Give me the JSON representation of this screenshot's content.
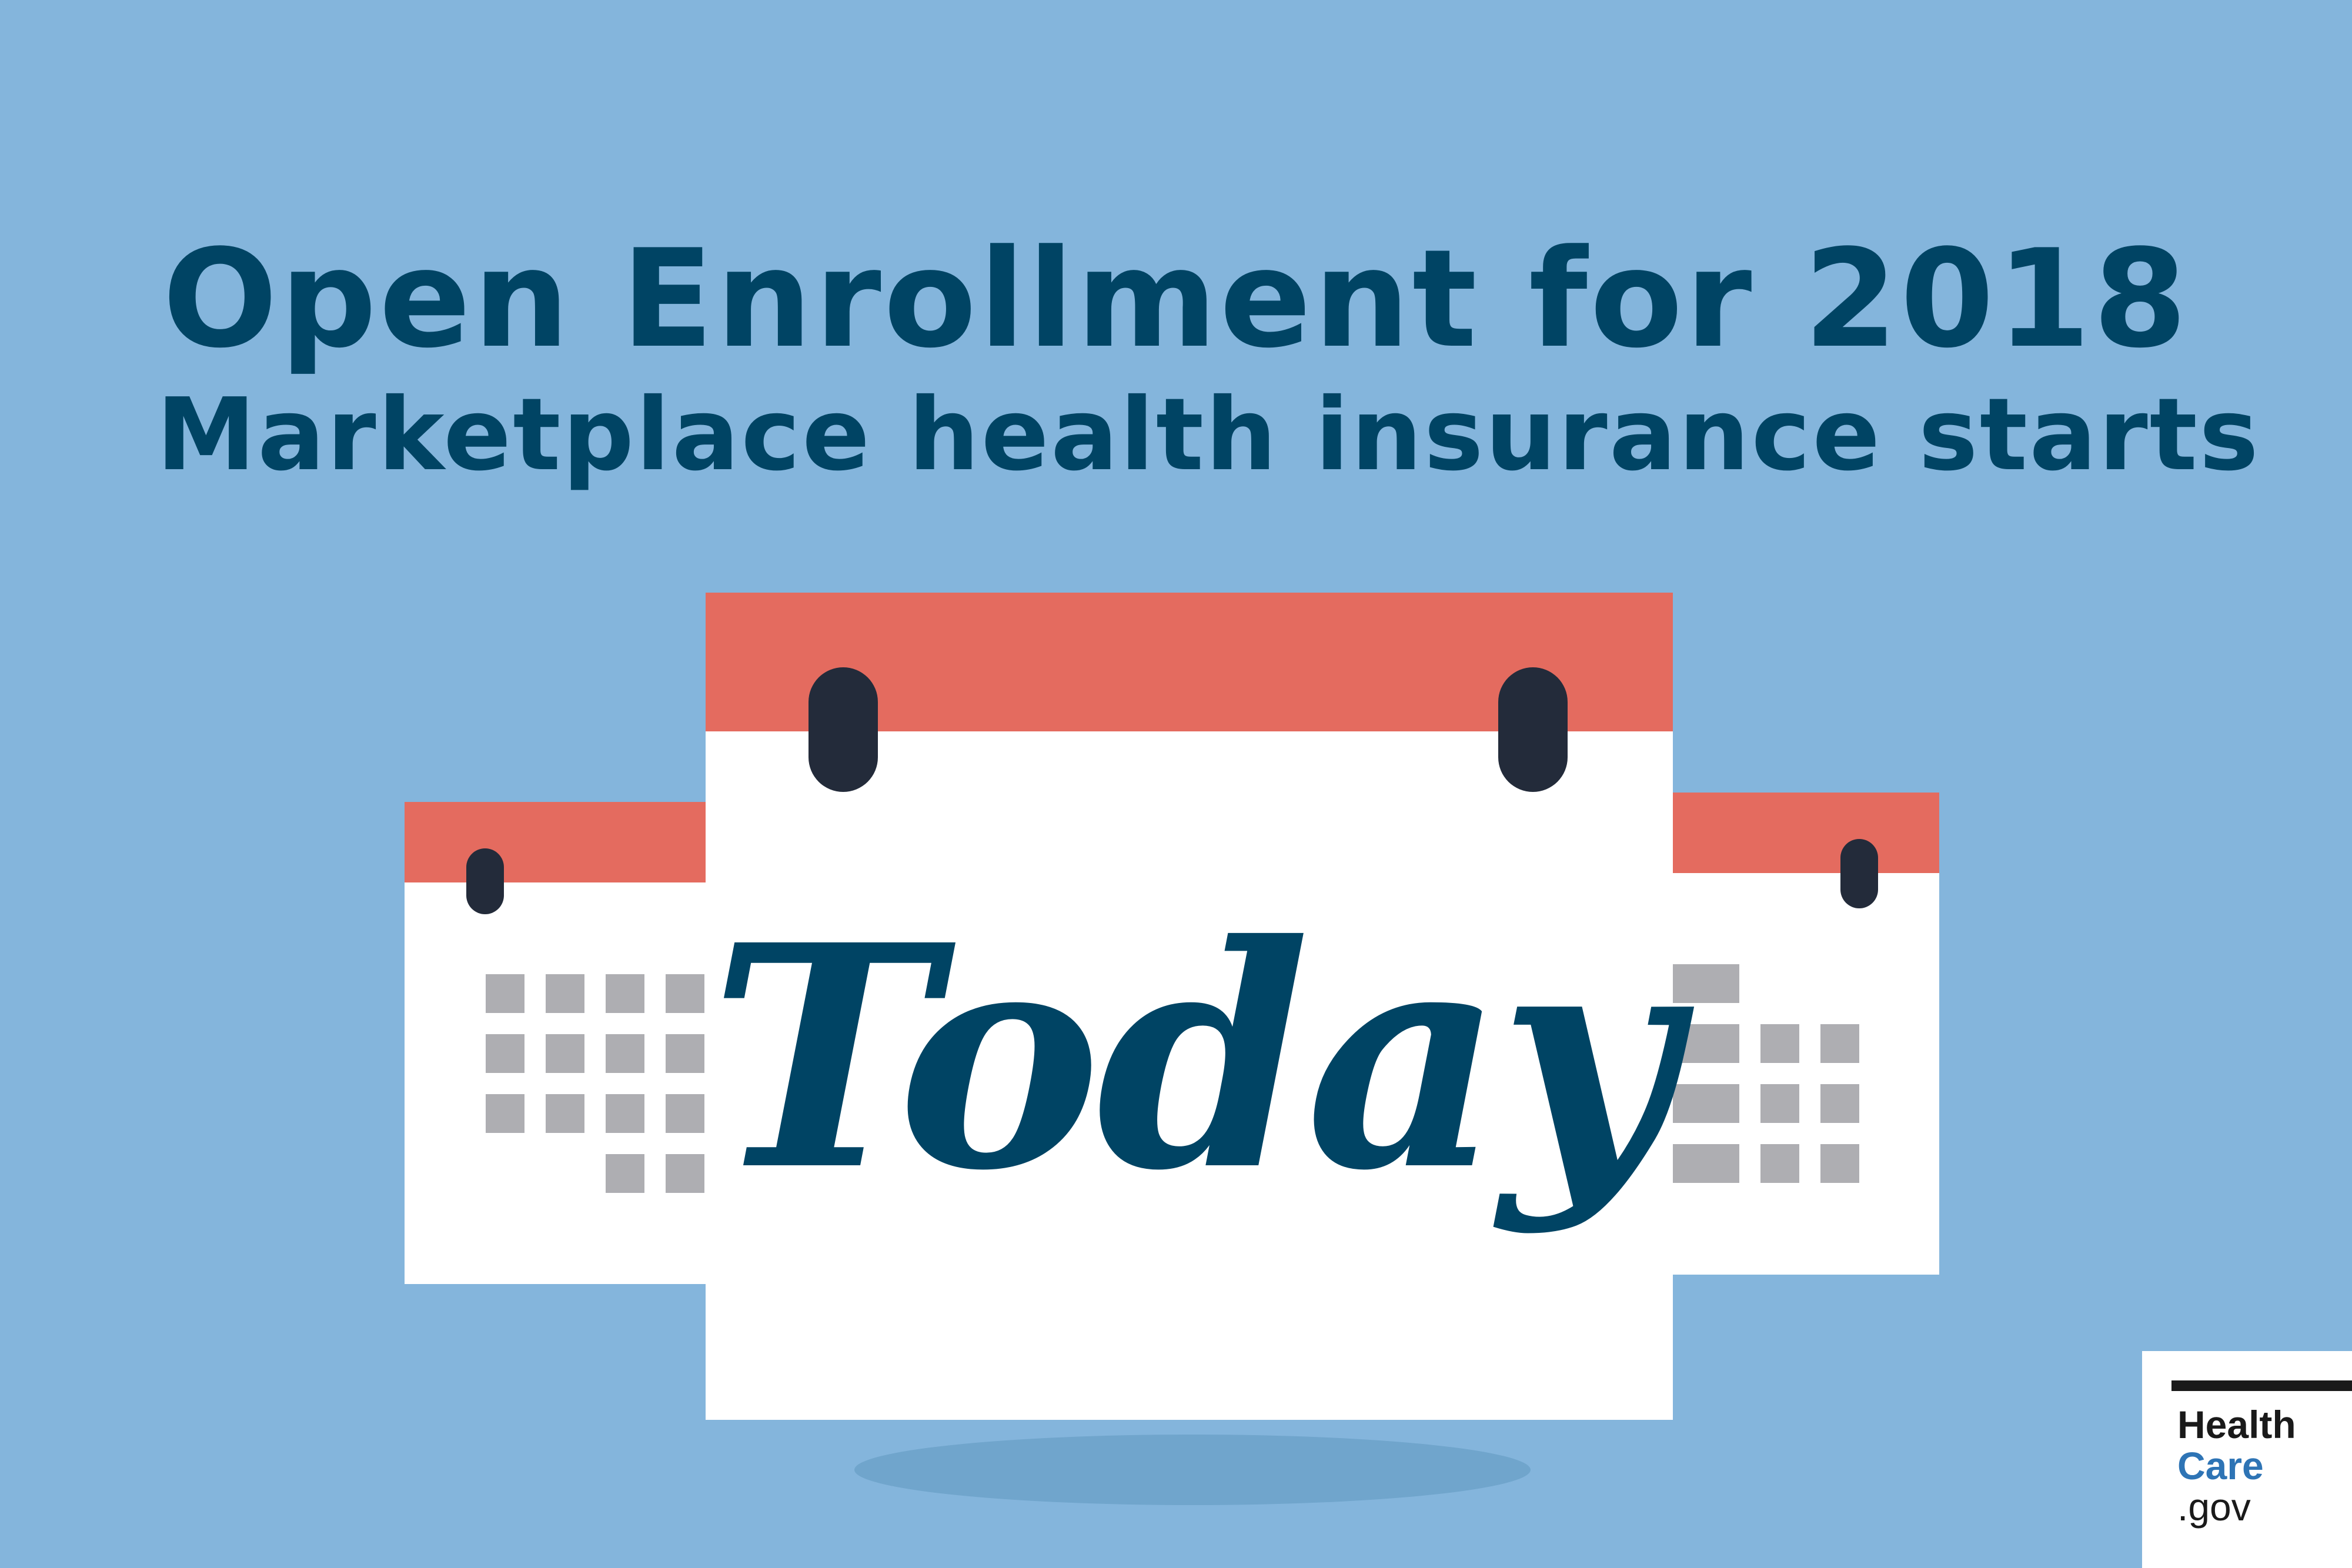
{
  "title": {
    "line1": "Open Enrollment for 2018",
    "line2": "Marketplace health insurance starts"
  },
  "calendar": {
    "label": "Today"
  },
  "logo": {
    "line1": "Health",
    "line2": "Care",
    "line3": ".gov"
  },
  "colors": {
    "background": "#84b5dc",
    "title_text": "#004464",
    "calendar_header": "#e46b5f",
    "calendar_page": "#ffffff",
    "binding_ring": "#232b3a",
    "day_square": "#aeaeb2",
    "shadow": "#70a5cc",
    "logo_care": "#2e74b5"
  }
}
